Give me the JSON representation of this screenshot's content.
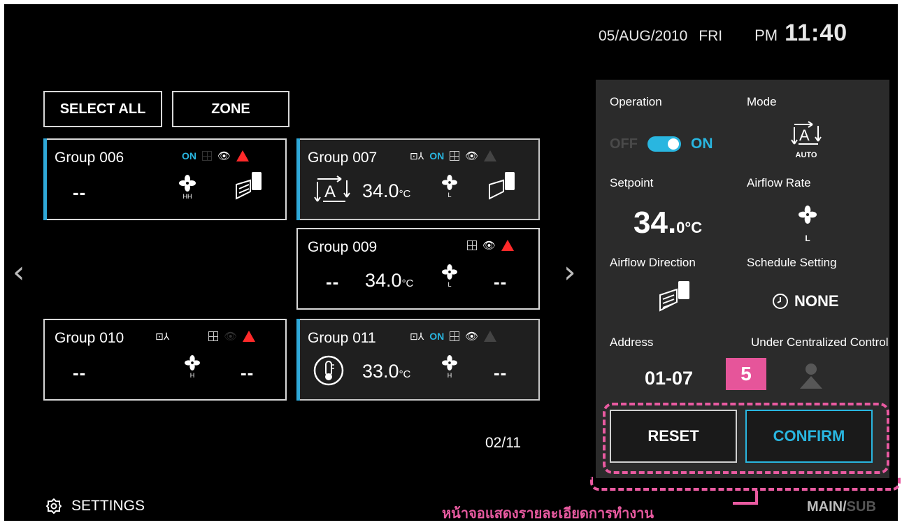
{
  "header": {
    "date": "05/AUG/2010",
    "day": "FRI",
    "ampm": "PM",
    "time": "11:40"
  },
  "top_buttons": {
    "select_all": "SELECT ALL",
    "zone": "ZONE"
  },
  "groups": [
    {
      "name": "Group 006",
      "on": "ON",
      "value": "--",
      "fan_level": "HH"
    },
    {
      "name": "Group 007",
      "on": "ON",
      "temp": "34.0",
      "unit": "°C",
      "fan_level": "L"
    },
    {
      "name": "Group 009",
      "value": "--",
      "temp": "34.0",
      "unit": "°C",
      "fan_level": "L",
      "right_value": "--"
    },
    {
      "name": "Group 010",
      "value": "--",
      "fan_level": "H",
      "right_value": "--"
    },
    {
      "name": "Group 011",
      "on": "ON",
      "temp": "33.0",
      "unit": "°C",
      "fan_level": "H",
      "right_value": "--"
    }
  ],
  "pager": "02/11",
  "footer": {
    "settings": "SETTINGS",
    "main": "MAIN",
    "sub": "SUB"
  },
  "panel": {
    "operation_label": "Operation",
    "off": "OFF",
    "on": "ON",
    "mode_label": "Mode",
    "mode_value": "AUTO",
    "setpoint_label": "Setpoint",
    "setpoint_value": "34.",
    "setpoint_unit": "0°C",
    "airflow_rate_label": "Airflow Rate",
    "airflow_rate_value": "L",
    "airflow_direction_label": "Airflow Direction",
    "schedule_label": "Schedule Setting",
    "schedule_value": "NONE",
    "address_label": "Address",
    "address_value": "01-07",
    "central_label": "Under Centralized Control",
    "reset": "RESET",
    "confirm": "CONFIRM"
  },
  "annotation": {
    "number": "5",
    "caption": "หน้าจอแสดงรายละเอียดการทำงาน"
  },
  "colors": {
    "accent": "#29b6e0",
    "warning": "#ff2a2a",
    "annotation": "#e85aa0",
    "panel": "#2b2b2b"
  },
  "icons": [
    "fan-icon",
    "louver-icon",
    "auto-mode-icon",
    "thermometer-icon",
    "eye-icon",
    "warning-icon",
    "filter-grid-icon",
    "clock-icon",
    "settings-gear-icon",
    "chevron-left-icon",
    "chevron-right-icon"
  ]
}
